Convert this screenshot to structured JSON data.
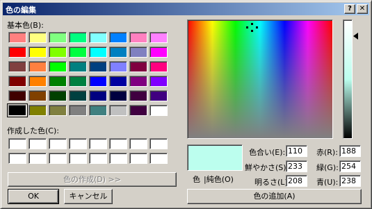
{
  "window": {
    "title": "色の編集",
    "help_glyph": "?",
    "close_glyph": "✕"
  },
  "basic_colors": {
    "label": "基本色(B):",
    "rows": [
      [
        "#ff8080",
        "#ffff80",
        "#80ff80",
        "#00ff80",
        "#80ffff",
        "#0080ff",
        "#ff80c0",
        "#ff80ff"
      ],
      [
        "#ff0000",
        "#ffff00",
        "#80ff00",
        "#00ff40",
        "#00ffff",
        "#0080c0",
        "#8080c0",
        "#ff00ff"
      ],
      [
        "#804040",
        "#ff8040",
        "#00ff00",
        "#008080",
        "#004080",
        "#8080ff",
        "#800040",
        "#ff0080"
      ],
      [
        "#800000",
        "#ff8000",
        "#008000",
        "#008040",
        "#0000ff",
        "#0000a0",
        "#800080",
        "#8000ff"
      ],
      [
        "#400000",
        "#804000",
        "#004000",
        "#004040",
        "#000080",
        "#000040",
        "#400040",
        "#400080"
      ],
      [
        "#000000",
        "#808000",
        "#808040",
        "#808080",
        "#408080",
        "#c0c0c0",
        "#400040",
        "#ffffff"
      ]
    ],
    "selected_index": 40
  },
  "custom_colors": {
    "label": "作成した色(C):",
    "rows": [
      [
        "#ffffff",
        "#ffffff",
        "#ffffff",
        "#ffffff",
        "#ffffff",
        "#ffffff",
        "#ffffff",
        "#ffffff"
      ],
      [
        "#ffffff",
        "#ffffff",
        "#ffffff",
        "#ffffff",
        "#ffffff",
        "#ffffff",
        "#ffffff",
        "#ffffff"
      ]
    ]
  },
  "buttons": {
    "define_custom": "色の作成(D) >>",
    "ok": "OK",
    "cancel": "キャンセル",
    "add_to_custom": "色の追加(A)"
  },
  "preview": {
    "color": "#bcfeee",
    "label_color": "色",
    "label_solid": "|純色(O)"
  },
  "fields": {
    "hue_label": "色合い(E):",
    "hue_value": "110",
    "sat_label": "鮮やかさ(S):",
    "sat_value": "233",
    "lum_label": "明るさ(L):",
    "lum_value": "208",
    "red_label": "赤(R):",
    "red_value": "188",
    "green_label": "緑(G):",
    "green_value": "254",
    "blue_label": "青(U):",
    "blue_value": "238"
  }
}
